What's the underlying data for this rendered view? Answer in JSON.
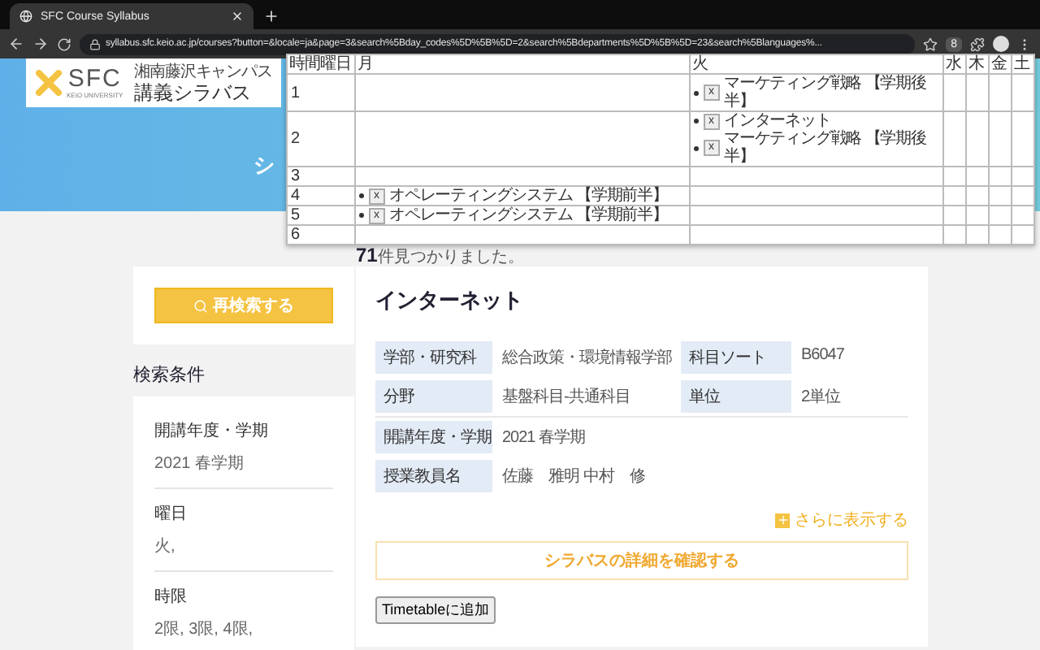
{
  "browser": {
    "tab_title": "SFC Course Syllabus",
    "url": "syllabus.sfc.keio.ac.jp/courses?button=&locale=ja&page=3&search%5Bday_codes%5D%5B%5D=2&search%5Bdepartments%5D%5B%5D=23&search%5Blanguages%...",
    "extension_badge": "8"
  },
  "header": {
    "logo": {
      "wordmark": "SFC",
      "tagline": "KEIO UNIVERSITY",
      "subtitle": "湘南藤沢キャンパス",
      "title": "講義シラバス"
    },
    "banner_title": "シ"
  },
  "timetable": {
    "columns": [
      "時間曜日",
      "月",
      "火",
      "水",
      "木",
      "金",
      "土"
    ],
    "rows": [
      {
        "cells": [
          {
            "period": "1"
          },
          {},
          {
            "entries": [
              {
                "remove": "x",
                "title": "マーケティング戦略 【学期後半】"
              }
            ]
          },
          {},
          {},
          {},
          {}
        ]
      },
      {
        "cells": [
          {
            "period": "2"
          },
          {},
          {
            "entries": [
              {
                "remove": "x",
                "title": "インターネット"
              },
              {
                "remove": "x",
                "title": "マーケティング戦略 【学期後半】"
              }
            ]
          },
          {},
          {},
          {},
          {}
        ]
      },
      {
        "cells": [
          {
            "period": "3"
          },
          {},
          {},
          {},
          {},
          {},
          {}
        ]
      },
      {
        "cells": [
          {
            "period": "4"
          },
          {
            "entries": [
              {
                "remove": "x",
                "title": "オペレーティングシステム 【学期前半】"
              }
            ]
          },
          {},
          {},
          {},
          {},
          {}
        ]
      },
      {
        "cells": [
          {
            "period": "5"
          },
          {
            "entries": [
              {
                "remove": "x",
                "title": "オペレーティングシステム 【学期前半】"
              }
            ]
          },
          {},
          {},
          {},
          {},
          {}
        ]
      },
      {
        "cells": [
          {
            "period": "6"
          },
          {},
          {},
          {},
          {},
          {},
          {}
        ]
      }
    ]
  },
  "sidebar": {
    "research_button": "再検索する",
    "conditions_title": "検索条件",
    "conditions": [
      {
        "label": "開講年度・学期",
        "value": "2021 春学期"
      },
      {
        "label": "曜日",
        "value": "火,"
      },
      {
        "label": "時限",
        "value": "2限, 3限, 4限,"
      }
    ]
  },
  "results": {
    "count": "71",
    "count_suffix": "件見つかりました。",
    "course": {
      "title": "インターネット",
      "info_rows": [
        [
          {
            "label": "学部・研究科",
            "value": "総合政策・環境情報学部"
          },
          {
            "label": "科目ソート",
            "value": "B6047"
          }
        ],
        [
          {
            "label": "分野",
            "value": "基盤科目-共通科目"
          },
          {
            "label": "単位",
            "value": "2単位"
          }
        ],
        [
          {
            "label": "開講年度・学期",
            "value": "2021 春学期"
          }
        ],
        [
          {
            "label": "授業教員名",
            "value": "佐藤　雅明 中村　修"
          }
        ]
      ],
      "more_link": "さらに表示する",
      "details_button": "シラバスの詳細を確認する",
      "timetable_button": "Timetableに追加"
    }
  }
}
